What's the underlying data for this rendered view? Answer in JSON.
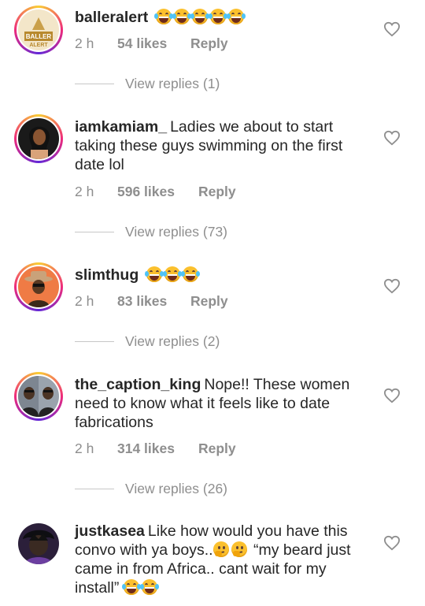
{
  "comments": [
    {
      "username": "balleralert",
      "text": "",
      "emoji_after": [
        "laugh",
        "laugh",
        "laugh",
        "laugh",
        "laugh"
      ],
      "time": "2 h",
      "likes": "54 likes",
      "reply": "Reply",
      "view_replies": "View replies (1)"
    },
    {
      "username": "iamkamiam_",
      "text": "Ladies we about to start taking these guys swimming on the first date lol",
      "time": "2 h",
      "likes": "596 likes",
      "reply": "Reply",
      "view_replies": "View replies (73)"
    },
    {
      "username": "slimthug",
      "text": "",
      "emoji_after": [
        "laugh",
        "laugh",
        "laugh"
      ],
      "time": "2 h",
      "likes": "83 likes",
      "reply": "Reply",
      "view_replies": "View replies (2)"
    },
    {
      "username": "the_caption_king",
      "text": "Nope!! These women need to know what it feels like to date fabrications",
      "time": "2 h",
      "likes": "314 likes",
      "reply": "Reply",
      "view_replies": "View replies (26)"
    },
    {
      "username": "justkasea",
      "text_part1": "Like how would you have this convo with ya boys..",
      "text_part2": "“my beard just came in from Africa.. cant wait for my install”"
    }
  ],
  "icons": {
    "like": "heart-outline-icon"
  },
  "colors": {
    "muted": "#8e8e8e",
    "text": "#262626",
    "story_ring": "#ee2a7b"
  }
}
